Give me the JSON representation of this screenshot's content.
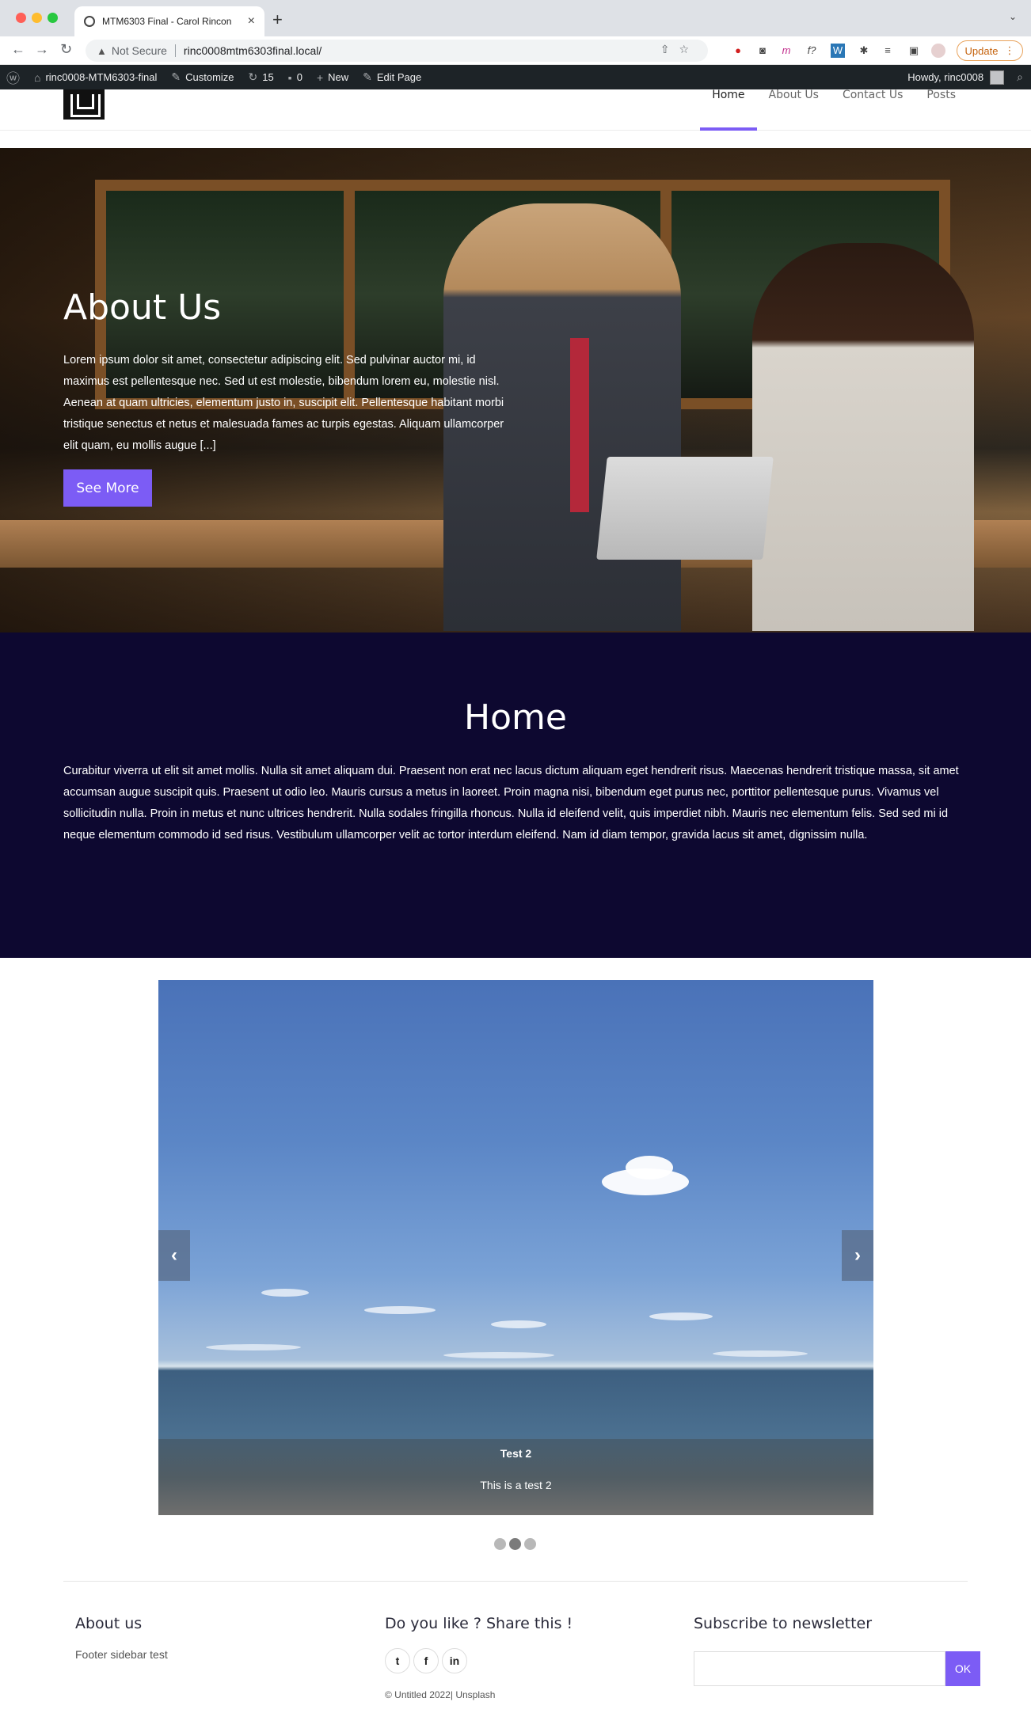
{
  "browser": {
    "tab_title": "MTM6303 Final - Carol Rincon",
    "new_tab": "+",
    "not_secure": "Not Secure",
    "url": "rinc0008mtm6303final.local/",
    "update_label": "Update"
  },
  "adminbar": {
    "site_name": "rinc0008-MTM6303-final",
    "customize": "Customize",
    "updates_count": "15",
    "comments_count": "0",
    "new_label": "New",
    "edit_page": "Edit Page",
    "howdy": "Howdy, rinc0008"
  },
  "nav": {
    "items": [
      {
        "label": "Home",
        "active": true
      },
      {
        "label": "About Us",
        "active": false
      },
      {
        "label": "Contact Us",
        "active": false
      },
      {
        "label": "Posts",
        "active": false
      }
    ]
  },
  "hero": {
    "title": "About Us",
    "text": "Lorem ipsum dolor sit amet, consectetur adipiscing elit. Sed pulvinar auctor mi, id maximus est pellentesque nec. Sed ut est molestie, bibendum lorem eu, molestie nisl. Aenean at quam ultricies, elementum justo in, suscipit elit. Pellentesque habitant morbi tristique senectus et netus et malesuada fames ac turpis egestas. Aliquam ullamcorper elit quam, eu mollis augue [...]",
    "button": "See More"
  },
  "home": {
    "title": "Home",
    "text": "Curabitur viverra ut elit sit amet mollis. Nulla sit amet aliquam dui. Praesent non erat nec lacus dictum aliquam eget hendrerit risus. Maecenas hendrerit tristique massa, sit amet accumsan augue suscipit quis. Praesent ut odio leo. Mauris cursus a metus in laoreet. Proin magna nisi, bibendum eget purus nec, porttitor pellentesque purus. Vivamus vel sollicitudin nulla. Proin in metus et nunc ultrices hendrerit. Nulla sodales fringilla rhoncus. Nulla id eleifend velit, quis imperdiet nibh. Mauris nec elementum felis. Sed sed mi id neque elementum commodo id sed risus. Vestibulum ullamcorper velit ac tortor interdum eleifend. Nam id diam tempor, gravida lacus sit amet, dignissim nulla."
  },
  "carousel": {
    "caption_title": "Test 2",
    "caption_text": "This is a test 2",
    "prev": "‹",
    "next": "›",
    "slide_count": 3,
    "active_slide": 2
  },
  "footer": {
    "about_heading": "About us",
    "about_text": "Footer sidebar test",
    "share_heading": "Do you like ? Share this !",
    "socials": [
      "twitter-icon",
      "facebook-icon",
      "linkedin-icon"
    ],
    "copyright": "© Untitled 2022| Unsplash",
    "newsletter_heading": "Subscribe to newsletter",
    "newsletter_button": "OK"
  },
  "colors": {
    "accent": "#7c5cf5",
    "home_bg": "#0d0830",
    "adminbar_bg": "#1d2327"
  }
}
